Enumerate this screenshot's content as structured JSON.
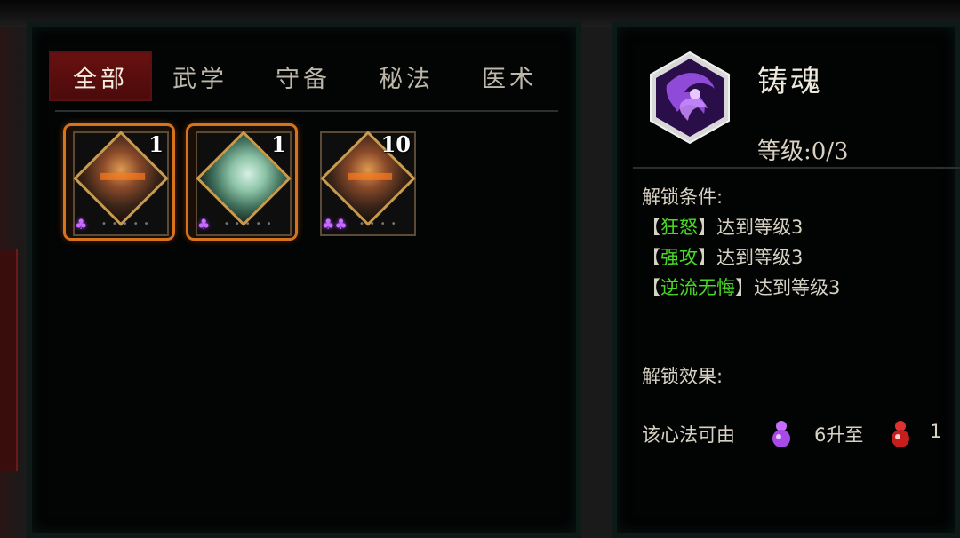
{
  "tabs": [
    {
      "label": "全部",
      "active": true
    },
    {
      "label": "武学",
      "active": false
    },
    {
      "label": "守备",
      "active": false
    },
    {
      "label": "秘法",
      "active": false
    },
    {
      "label": "医术",
      "active": false
    }
  ],
  "items": [
    {
      "count": "1",
      "icon": "face-portrait-icon",
      "gourds": "♣",
      "selected": true
    },
    {
      "count": "1",
      "icon": "ghost-figure-icon",
      "gourds": "♣",
      "selected": true
    },
    {
      "count": "10",
      "icon": "face-portrait-icon",
      "gourds": "♣♣",
      "selected": false
    }
  ],
  "detail": {
    "name": "铸魂",
    "level": "等级:0/3",
    "unlock_conditions_label": "解锁条件:",
    "conditions": [
      {
        "open": "【",
        "name": "狂怒",
        "close": "】",
        "text": "达到等级3"
      },
      {
        "open": "【",
        "name": "强攻",
        "close": "】",
        "text": "达到等级3"
      },
      {
        "open": "【",
        "name": "逆流无悔",
        "close": "】",
        "text": "达到等级3"
      }
    ],
    "unlock_effect_label": "解锁效果:",
    "effect": {
      "prefix": "该心法可由",
      "from_count": "6升至",
      "to_count": "1"
    }
  },
  "colors": {
    "active_tab": "#5a0f0f",
    "condition_name": "#4ad826",
    "selected_border": "#d6731d",
    "purple_gourd": "#c66cff",
    "red_gourd": "#e03030"
  }
}
